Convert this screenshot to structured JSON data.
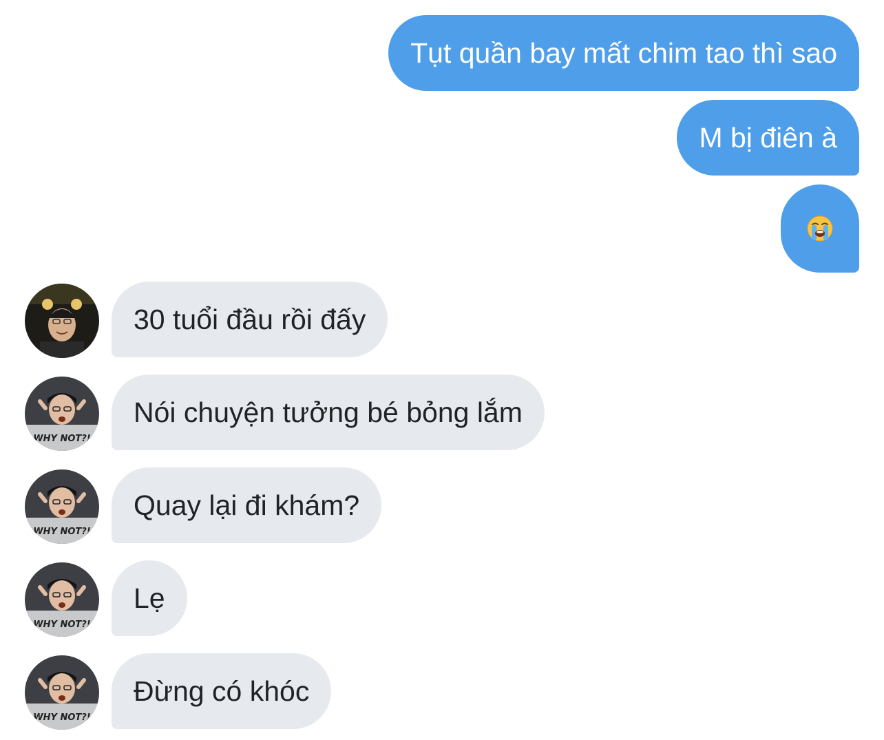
{
  "conversation": {
    "outgoing": [
      {
        "text": "Tụt quần bay mất chim tao thì sao"
      },
      {
        "text": "M bị điên à"
      },
      {
        "emoji": "loudly-crying-face"
      }
    ],
    "incoming": [
      {
        "text": "30 tuổi đầu rồi đấy",
        "sender": "user-a"
      },
      {
        "text": "Nói chuyện tưởng bé bỏng lắm",
        "sender": "user-b"
      },
      {
        "text": "Quay lại đi khám?",
        "sender": "user-b"
      },
      {
        "text": "Lẹ",
        "sender": "user-b"
      },
      {
        "text": "Đừng có khóc",
        "sender": "user-b"
      }
    ]
  },
  "colors": {
    "outgoing_bubble": "#4e9ee9",
    "incoming_bubble": "#e6eaee",
    "outgoing_text": "#ffffff",
    "incoming_text": "#1f2326"
  },
  "avatars": {
    "user-a": {
      "shirt_print": ""
    },
    "user-b": {
      "shirt_print": "WHY NOT?!"
    }
  }
}
